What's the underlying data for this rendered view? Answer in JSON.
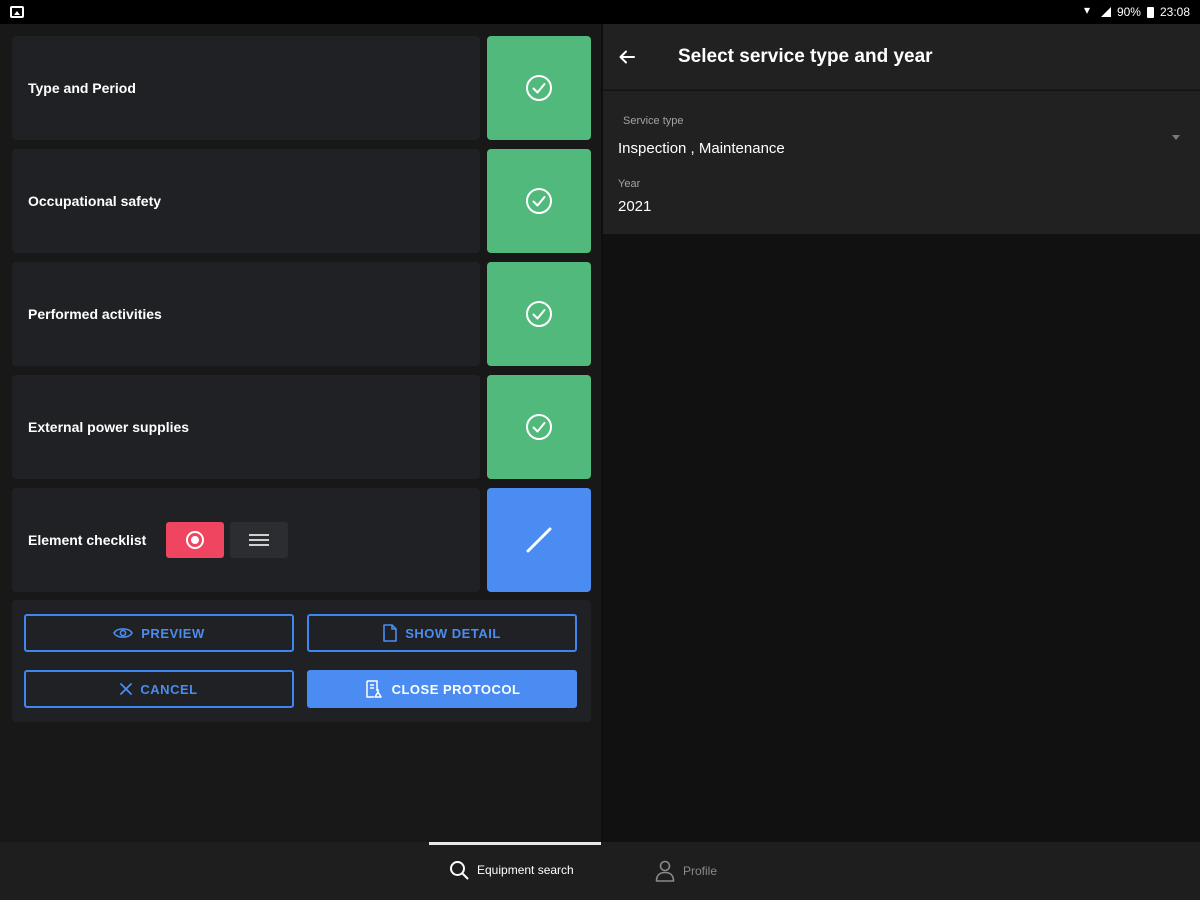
{
  "status_bar": {
    "battery": "90%",
    "time": "23:08"
  },
  "sections": [
    {
      "label": "Type and Period",
      "state": "done"
    },
    {
      "label": "Occupational safety",
      "state": "done"
    },
    {
      "label": "Performed activities",
      "state": "done"
    },
    {
      "label": "External power supplies",
      "state": "done"
    },
    {
      "label": "Element checklist",
      "state": "edit"
    }
  ],
  "actions": {
    "preview": "PREVIEW",
    "show_detail": "SHOW DETAIL",
    "cancel": "CANCEL",
    "close_protocol": "CLOSE PROTOCOL"
  },
  "detail": {
    "title": "Select service type and year",
    "service_type_label": "Service type",
    "service_type_value": "Inspection , Maintenance",
    "year_label": "Year",
    "year_value": "2021"
  },
  "bottom_nav": {
    "equipment_search": "Equipment search",
    "profile": "Profile"
  },
  "colors": {
    "done": "#52b97c",
    "edit": "#4a8cf2",
    "record": "#f04560",
    "accent": "#4a8cf2"
  }
}
